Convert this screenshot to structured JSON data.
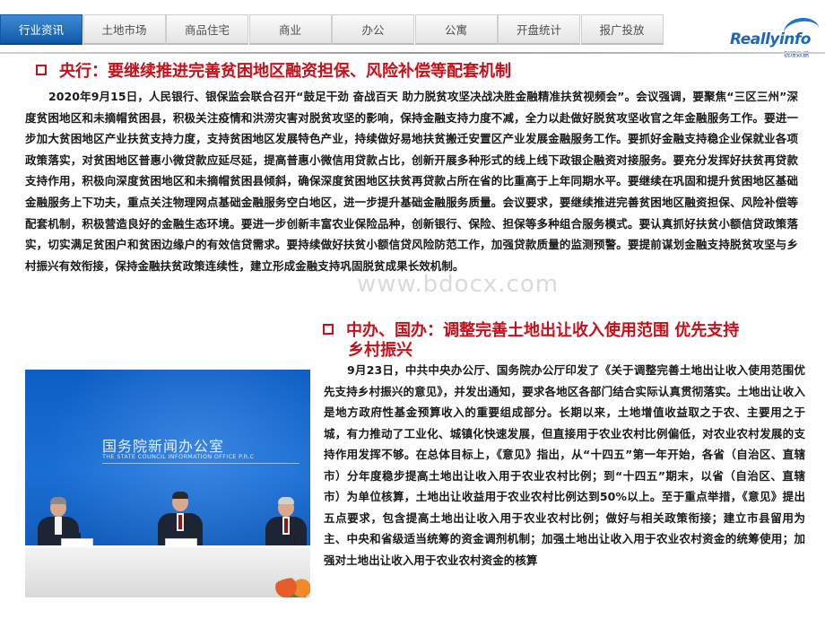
{
  "nav": {
    "tabs": [
      {
        "label": "行业资讯",
        "active": true
      },
      {
        "label": "土地市场",
        "active": false
      },
      {
        "label": "商品住宅",
        "active": false
      },
      {
        "label": "商业",
        "active": false
      },
      {
        "label": "办公",
        "active": false
      },
      {
        "label": "公寓",
        "active": false
      },
      {
        "label": "开盘统计",
        "active": false
      },
      {
        "label": "报广投放",
        "active": false
      }
    ]
  },
  "logo": {
    "name": "Reallyinfo",
    "sub": "锐理数据"
  },
  "section1": {
    "title": "央行：要继续推进完善贫困地区融资担保、风险补偿等配套机制",
    "body": "2020年9月15日，人民银行、银保监会联合召开“鼓足干劲 奋战百天 助力脱贫攻坚决战决胜金融精准扶贫视频会”。会议强调，要聚焦“三区三州”深度贫困地区和未摘帽贫困县，积极关注疫情和洪涝灾害对脱贫攻坚的影响，保持金融支持力度不减，全力以赴做好脱贫攻坚收官之年金融服务工作。要进一步加大贫困地区产业扶贫支持力度，支持贫困地区发展特色产业，持续做好易地扶贫搬迁安置区产业发展金融服务工作。要抓好金融支持稳企业保就业各项政策落实，对贫困地区普惠小微贷款应延尽延，提高普惠小微信用贷款占比，创新开展多种形式的线上线下政银企融资对接服务。要充分发挥好扶贫再贷款支持作用，积极向深度贫困地区和未摘帽贫困县倾斜，确保深度贫困地区扶贫再贷款占所在省的比重高于上年同期水平。要继续在巩固和提升贫困地区基础金融服务上下功夫，重点关注物理网点基础金融服务空白地区，进一步提升基础金融服务质量。会议要求，要继续推进完善贫困地区融资担保、风险补偿等配套机制，积极营造良好的金融生态环境。要进一步创新丰富农业保险品种，创新银行、保险、担保等多种组合服务模式。要认真抓好扶贫小额信贷政策落实，切实满足贫困户和贫困边缘户的有效信贷需求。要持续做好扶贫小额信贷风险防范工作，加强贷款质量的监测预警。要提前谋划金融支持脱贫攻坚与乡村振兴有效衔接，保持金融扶贫政策连续性，建立形成金融支持巩固脱贫成果长效机制。"
  },
  "section2": {
    "title_line1": "中办、国办：调整完善土地出让收入使用范围 优先支持",
    "title_line2": "乡村振兴",
    "body": "9月23日，中共中央办公厅、国务院办公厅印发了《关于调整完善土地出让收入使用范围优先支持乡村振兴的意见》，并发出通知，要求各地区各部门结合实际认真贯彻落实。土地出让收入是地方政府性基金预算收入的重要组成部分。长期以来，土地增值收益取之于农、主要用之于城，有力推动了工业化、城镇化快速发展，但直接用于农业农村比例偏低，对农业农村发展的支持作用发挥不够。在总体目标上，《意见》指出，从“十四五”第一年开始，各省（自治区、直辖市）分年度稳步提高土地出让收入用于农业农村比例；到“十四五”期末，以省（自治区、直辖市）为单位核算，土地出让收益用于农业农村比例达到50%以上。至于重点举措，《意见》提出五点要求，包含提高土地出让收入用于农业农村比例；做好与相关政策衔接；建立市县留用为主、中央和省级适当统筹的资金调剂机制；加强土地出让收入用于农业农村资金的统筹使用；加强对土地出让收入用于农业农村资金的核算"
  },
  "photo": {
    "backdrop_cn": "国务院新闻办公室",
    "backdrop_en": "THE STATE COUNCIL INFORMATION OFFICE P.R.C"
  },
  "watermark": "www.bdocx.com",
  "colors": {
    "heading_red": "#c6101a",
    "nav_active": "#1f66b5"
  }
}
